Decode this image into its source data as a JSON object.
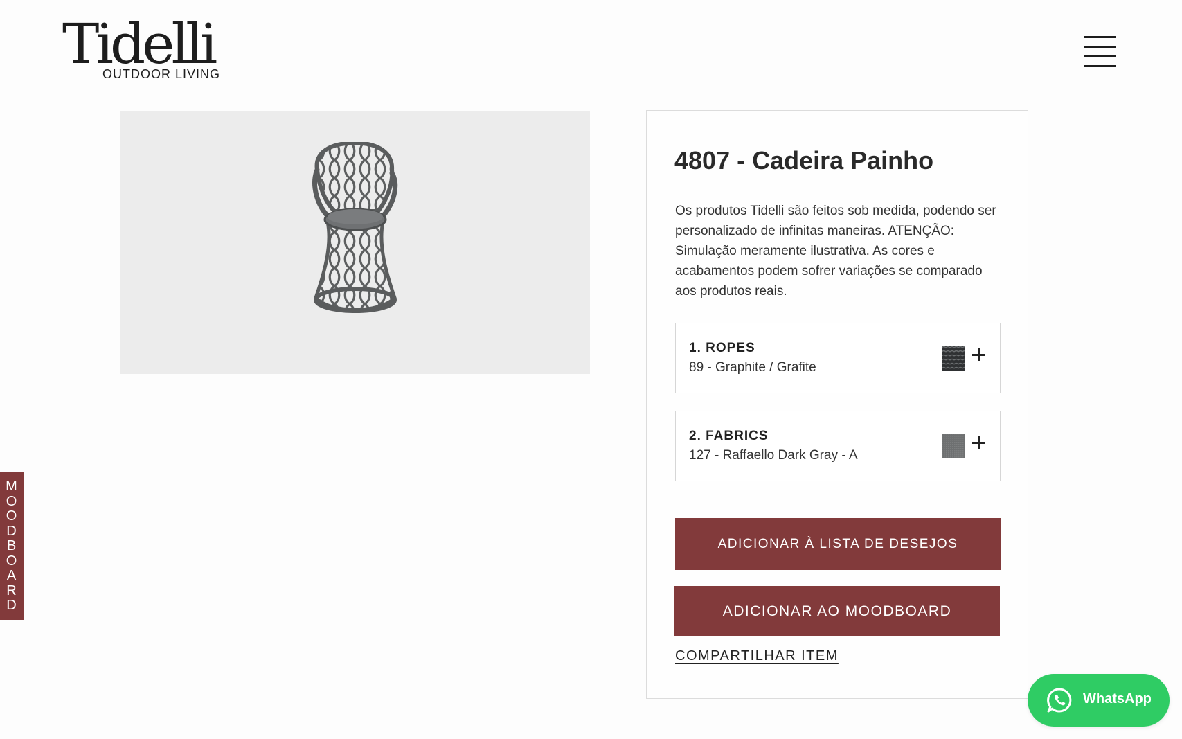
{
  "header": {
    "logo_main": "Tidelli",
    "logo_sub": "OUTDOOR LIVING",
    "menu_icon": "hamburger-menu-icon"
  },
  "product": {
    "image_icon": "rattan-chair-image",
    "title": "4807 - Cadeira Painho",
    "description": "Os produtos Tidelli são feitos sob medida, podendo ser personalizado de infinitas maneiras. ATENÇÃO: Simulação meramente ilustrativa. As cores e acabamentos podem sofrer variações se comparado aos produtos reais."
  },
  "options": [
    {
      "title": "1. ROPES",
      "value": "89 - Graphite / Grafite",
      "swatch_color": "#3f4244",
      "expand_icon": "plus-icon"
    },
    {
      "title": "2. FABRICS",
      "value": "127 - Raffaello Dark Gray - A",
      "swatch_color": "#6e7071",
      "expand_icon": "plus-icon"
    }
  ],
  "actions": {
    "wishlist_label": "ADICIONAR À LISTA DE DESEJOS",
    "moodboard_label": "ADICIONAR AO MOODBOARD",
    "share_label": "COMPARTILHAR ITEM"
  },
  "side_tab": {
    "letters": [
      "M",
      "O",
      "O",
      "D",
      "B",
      "O",
      "A",
      "R",
      "D"
    ]
  },
  "whatsapp": {
    "label": "WhatsApp",
    "icon": "whatsapp-icon"
  },
  "colors": {
    "accent": "#823a3b",
    "whatsapp_green": "#2fcc64",
    "image_background": "#ececec"
  }
}
